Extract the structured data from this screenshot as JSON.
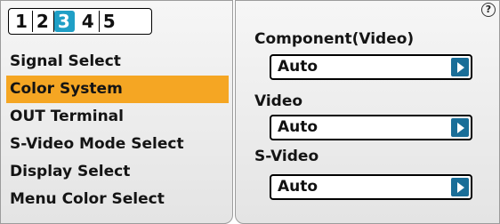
{
  "tabs": [
    {
      "label": "1"
    },
    {
      "label": "2"
    },
    {
      "label": "3"
    },
    {
      "label": "4"
    },
    {
      "label": "5"
    }
  ],
  "active_tab": "3",
  "menu": {
    "items": [
      {
        "label": "Signal Select"
      },
      {
        "label": "Color System"
      },
      {
        "label": "OUT Terminal"
      },
      {
        "label": "S-Video Mode Select"
      },
      {
        "label": "Display Select"
      },
      {
        "label": "Menu Color Select"
      }
    ],
    "selected": "Color System"
  },
  "help": {
    "label": "?"
  },
  "settings": {
    "component": {
      "label": "Component(Video)",
      "value": "Auto"
    },
    "video": {
      "label": "Video",
      "value": "Auto"
    },
    "svideo": {
      "label": "S-Video",
      "value": "Auto"
    }
  },
  "colors": {
    "highlight": "#f5a623",
    "active_tab": "#1f9fc6",
    "dropdown_arrow": "#1a6e98"
  }
}
